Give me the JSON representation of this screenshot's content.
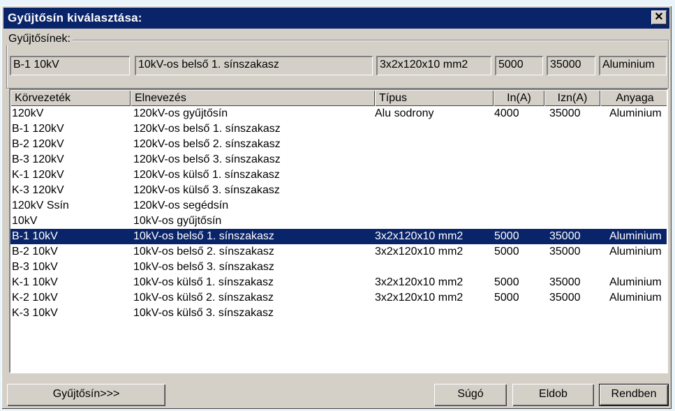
{
  "dialog": {
    "title": "Gyűjtősín kiválasztása:",
    "close_glyph": "✕"
  },
  "group": {
    "label": "Gyűjtősínek:",
    "fields": {
      "korvezetek": "B-1 10kV",
      "elnevezes": "10kV-os belső 1. sínszakasz",
      "tipus": "3x2x120x10 mm2",
      "in": "5000",
      "izn": "35000",
      "anyaga": "Aluminium"
    }
  },
  "table": {
    "columns": [
      "Körvezeték",
      "Elnevezés",
      "Típus",
      "In(A)",
      "Izn(A)",
      "Anyaga"
    ],
    "selected_index": 8,
    "rows": [
      [
        "120kV",
        "120kV-os gyűjtősín",
        "Alu sodrony",
        "4000",
        "35000",
        "Aluminium"
      ],
      [
        "B-1 120kV",
        "120kV-os belső 1. sínszakasz",
        "",
        "",
        "",
        ""
      ],
      [
        "B-2 120kV",
        "120kV-os belső 2. sínszakasz",
        "",
        "",
        "",
        ""
      ],
      [
        "B-3 120kV",
        "120kV-os belső 3. sínszakasz",
        "",
        "",
        "",
        ""
      ],
      [
        "K-1 120kV",
        "120kV-os külső 1. sínszakasz",
        "",
        "",
        "",
        ""
      ],
      [
        "K-3 120kV",
        "120kV-os külső 3. sínszakasz",
        "",
        "",
        "",
        ""
      ],
      [
        "120kV Ssín",
        "120kV-os segédsín",
        "",
        "",
        "",
        ""
      ],
      [
        "10kV",
        "10kV-os gyűjtősín",
        "",
        "",
        "",
        ""
      ],
      [
        "B-1 10kV",
        "10kV-os belső 1. sínszakasz",
        "3x2x120x10 mm2",
        "5000",
        "35000",
        "Aluminium"
      ],
      [
        "B-2 10kV",
        "10kV-os belső 2. sínszakasz",
        "3x2x120x10 mm2",
        "5000",
        "35000",
        "Aluminium"
      ],
      [
        "B-3 10kV",
        "10kV-os belső 3. sínszakasz",
        "",
        "",
        "",
        ""
      ],
      [
        "K-1 10kV",
        "10kV-os külső 1. sínszakasz",
        "3x2x120x10 mm2",
        "5000",
        "35000",
        "Aluminium"
      ],
      [
        "K-2 10kV",
        "10kV-os külső 2. sínszakasz",
        "3x2x120x10 mm2",
        "5000",
        "35000",
        "Aluminium"
      ],
      [
        "K-3 10kV",
        "10kV-os külső 3. sínszakasz",
        "",
        "",
        "",
        ""
      ]
    ]
  },
  "buttons": {
    "gyujtosin": "Gyűjtősín>>>",
    "sugo": "Súgó",
    "eldob": "Eldob",
    "rendben": "Rendben"
  },
  "colors": {
    "titlebar": "#0a246a",
    "selection": "#0a246a",
    "face": "#d4d0c8",
    "background": "#eaf4fb"
  }
}
